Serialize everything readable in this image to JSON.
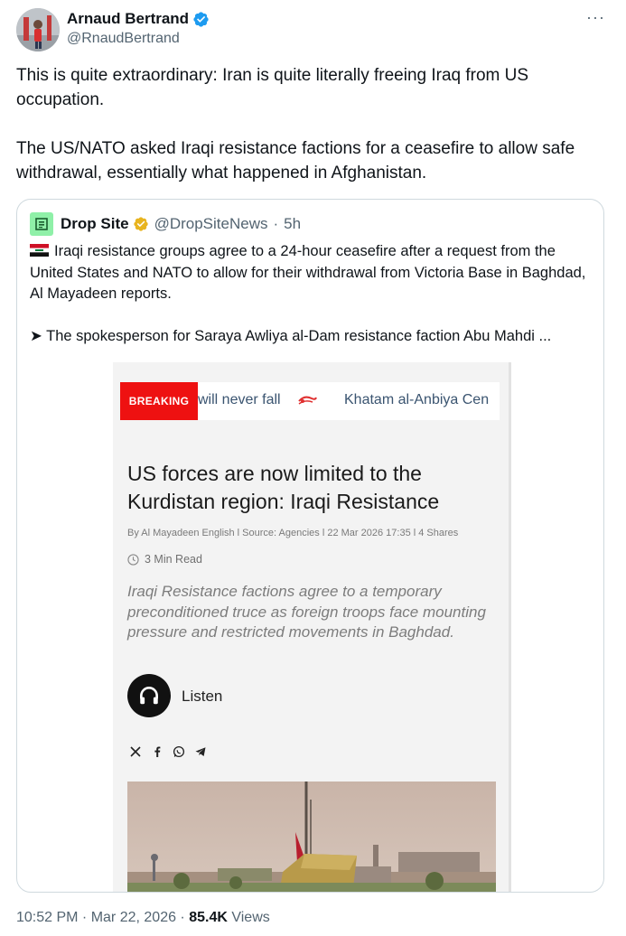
{
  "author": {
    "name": "Arnaud Bertrand",
    "handle": "@RnaudBertrand",
    "verified_color": "#1d9bf0"
  },
  "more_icon": "more-horizontal-icon",
  "more_glyph": "···",
  "tweet": {
    "paragraph_1": "This is quite extraordinary: Iran is quite literally freeing Iraq from US occupation.",
    "paragraph_2": "The US/NATO asked Iraqi resistance factions for a ceasefire to allow safe withdrawal, essentially what happened in Afghanistan."
  },
  "quote": {
    "name": "Drop Site",
    "handle": "@DropSiteNews",
    "separator": "·",
    "time": "5h",
    "verified_color": "#e8b420",
    "avatar_color": "#8ff0a8",
    "text_1": "Iraqi resistance groups agree to a 24-hour ceasefire after a request from the United States and NATO to allow for their withdrawal from Victoria Base in Baghdad, Al Mayadeen reports.",
    "text_2": "➤ The spokesperson for Saraya Awliya al-Dam resistance faction Abu Mahdi ..."
  },
  "embed": {
    "breaking_label": "BREAKING",
    "ticker_1": "will never fall",
    "ticker_2": "Khatam al-Anbiya Cen",
    "headline": "US forces are now limited to the Kurdistan region: Iraqi Resistance",
    "meta": "By  Al Mayadeen English  l Source: Agencies l 22 Mar 2026 17:35 l 4 Shares",
    "read_time": "3 Min Read",
    "lede": "Iraqi Resistance factions agree to a temporary preconditioned truce as foreign troops face mounting pressure and restricted movements in Baghdad.",
    "listen_label": "Listen",
    "breaking_color": "#ee1111",
    "share_icons": [
      "x-icon",
      "facebook-icon",
      "whatsapp-icon",
      "telegram-icon"
    ]
  },
  "footer": {
    "time": "10:52 PM",
    "sep_1": " · ",
    "date": "Mar 22, 2026",
    "sep_2": " · ",
    "views_count": "85.4K",
    "views_label": " Views"
  }
}
